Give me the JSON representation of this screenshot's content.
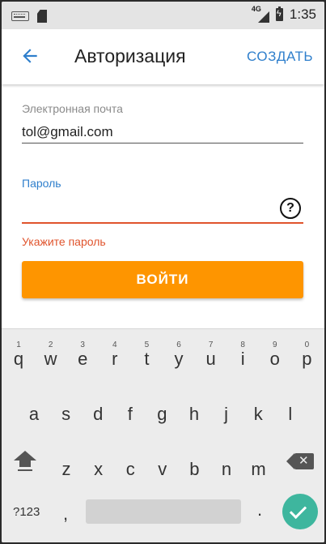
{
  "status_bar": {
    "network": "4G",
    "time": "1:35",
    "icons": [
      "keyboard-icon",
      "sd-card-icon",
      "signal-icon",
      "battery-charging-icon"
    ]
  },
  "app_bar": {
    "title": "Авторизация",
    "create_label": "СОЗДАТЬ",
    "back_icon": "arrow-back-icon"
  },
  "form": {
    "email_label": "Электронная почта",
    "email_value": "tol@gmail.com",
    "password_label": "Пароль",
    "password_value": "",
    "help_icon": "help-circle-icon",
    "error_text": "Укажите пароль",
    "login_label": "ВОЙТИ"
  },
  "colors": {
    "accent": "#2f7fcc",
    "button": "#fe9500",
    "error": "#e0542d",
    "enter_key": "#3eb69e"
  },
  "keyboard": {
    "row1": [
      {
        "ch": "q",
        "sup": "1"
      },
      {
        "ch": "w",
        "sup": "2"
      },
      {
        "ch": "e",
        "sup": "3"
      },
      {
        "ch": "r",
        "sup": "4"
      },
      {
        "ch": "t",
        "sup": "5"
      },
      {
        "ch": "y",
        "sup": "6"
      },
      {
        "ch": "u",
        "sup": "7"
      },
      {
        "ch": "i",
        "sup": "8"
      },
      {
        "ch": "o",
        "sup": "9"
      },
      {
        "ch": "p",
        "sup": "0"
      }
    ],
    "row2": [
      "a",
      "s",
      "d",
      "f",
      "g",
      "h",
      "j",
      "k",
      "l"
    ],
    "row3": [
      "z",
      "x",
      "c",
      "v",
      "b",
      "n",
      "m"
    ],
    "symbols_label": "?123",
    "comma": ",",
    "period": "."
  }
}
